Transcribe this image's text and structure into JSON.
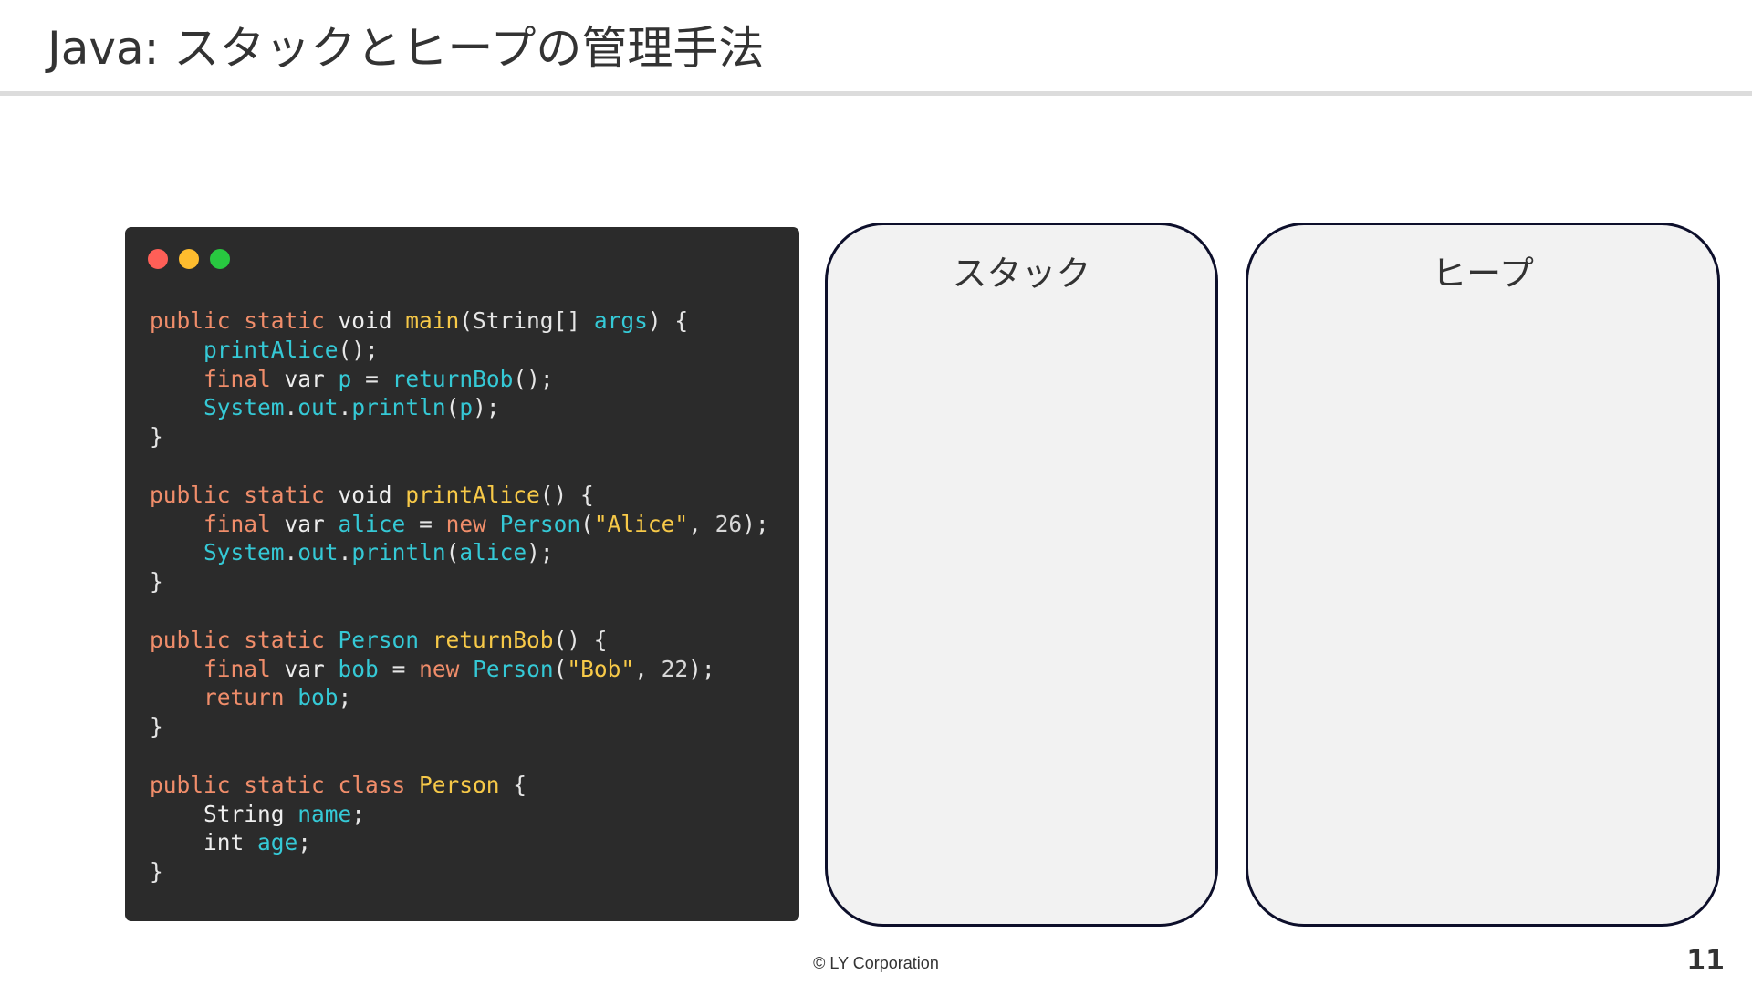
{
  "slide": {
    "title": "Java: スタックとヒープの管理手法",
    "footer": "© LY Corporation",
    "page_number": "11"
  },
  "code_window": {
    "lines": [
      [
        [
          "kw",
          "public static "
        ],
        [
          "id",
          "void "
        ],
        [
          "fn",
          "main"
        ],
        [
          "p",
          "(String[] "
        ],
        [
          "var",
          "args"
        ],
        [
          "p",
          ") {"
        ]
      ],
      [
        [
          "p",
          "    "
        ],
        [
          "var",
          "printAlice"
        ],
        [
          "p",
          "();"
        ]
      ],
      [
        [
          "p",
          "    "
        ],
        [
          "kw",
          "final "
        ],
        [
          "id",
          "var "
        ],
        [
          "var",
          "p"
        ],
        [
          "p",
          " = "
        ],
        [
          "var",
          "returnBob"
        ],
        [
          "p",
          "();"
        ]
      ],
      [
        [
          "p",
          "    "
        ],
        [
          "var",
          "System"
        ],
        [
          "p",
          "."
        ],
        [
          "var",
          "out"
        ],
        [
          "p",
          "."
        ],
        [
          "var",
          "println"
        ],
        [
          "p",
          "("
        ],
        [
          "var",
          "p"
        ],
        [
          "p",
          ");"
        ]
      ],
      [
        [
          "p",
          "}"
        ]
      ],
      [
        [
          "p",
          ""
        ]
      ],
      [
        [
          "kw",
          "public static "
        ],
        [
          "id",
          "void "
        ],
        [
          "fn",
          "printAlice"
        ],
        [
          "p",
          "() {"
        ]
      ],
      [
        [
          "p",
          "    "
        ],
        [
          "kw",
          "final "
        ],
        [
          "id",
          "var "
        ],
        [
          "var",
          "alice"
        ],
        [
          "p",
          " = "
        ],
        [
          "kw",
          "new "
        ],
        [
          "type",
          "Person"
        ],
        [
          "p",
          "("
        ],
        [
          "str",
          "\"Alice\""
        ],
        [
          "p",
          ", "
        ],
        [
          "num",
          "26"
        ],
        [
          "p",
          ");"
        ]
      ],
      [
        [
          "p",
          "    "
        ],
        [
          "var",
          "System"
        ],
        [
          "p",
          "."
        ],
        [
          "var",
          "out"
        ],
        [
          "p",
          "."
        ],
        [
          "var",
          "println"
        ],
        [
          "p",
          "("
        ],
        [
          "var",
          "alice"
        ],
        [
          "p",
          ");"
        ]
      ],
      [
        [
          "p",
          "}"
        ]
      ],
      [
        [
          "p",
          ""
        ]
      ],
      [
        [
          "kw",
          "public static "
        ],
        [
          "type",
          "Person "
        ],
        [
          "fn",
          "returnBob"
        ],
        [
          "p",
          "() {"
        ]
      ],
      [
        [
          "p",
          "    "
        ],
        [
          "kw",
          "final "
        ],
        [
          "id",
          "var "
        ],
        [
          "var",
          "bob"
        ],
        [
          "p",
          " = "
        ],
        [
          "kw",
          "new "
        ],
        [
          "type",
          "Person"
        ],
        [
          "p",
          "("
        ],
        [
          "str",
          "\"Bob\""
        ],
        [
          "p",
          ", "
        ],
        [
          "num",
          "22"
        ],
        [
          "p",
          ");"
        ]
      ],
      [
        [
          "p",
          "    "
        ],
        [
          "kw",
          "return "
        ],
        [
          "var",
          "bob"
        ],
        [
          "p",
          ";"
        ]
      ],
      [
        [
          "p",
          "}"
        ]
      ],
      [
        [
          "p",
          ""
        ]
      ],
      [
        [
          "kw",
          "public static class "
        ],
        [
          "cls",
          "Person"
        ],
        [
          "p",
          " {"
        ]
      ],
      [
        [
          "p",
          "    "
        ],
        [
          "id",
          "String "
        ],
        [
          "var",
          "name"
        ],
        [
          "p",
          ";"
        ]
      ],
      [
        [
          "p",
          "    "
        ],
        [
          "id",
          "int "
        ],
        [
          "var",
          "age"
        ],
        [
          "p",
          ";"
        ]
      ],
      [
        [
          "p",
          "}"
        ]
      ]
    ]
  },
  "panels": {
    "stack_label": "スタック",
    "heap_label": "ヒープ"
  },
  "colors": {
    "code_background": "#2b2b2b",
    "keyword": "#f08d6a",
    "function_name": "#f7c948",
    "identifier": "#35c9d6",
    "panel_border": "#0d0f2b",
    "panel_fill": "#f2f2f2",
    "dot_red": "#ff5f57",
    "dot_yellow": "#febc2e",
    "dot_green": "#28c840"
  }
}
